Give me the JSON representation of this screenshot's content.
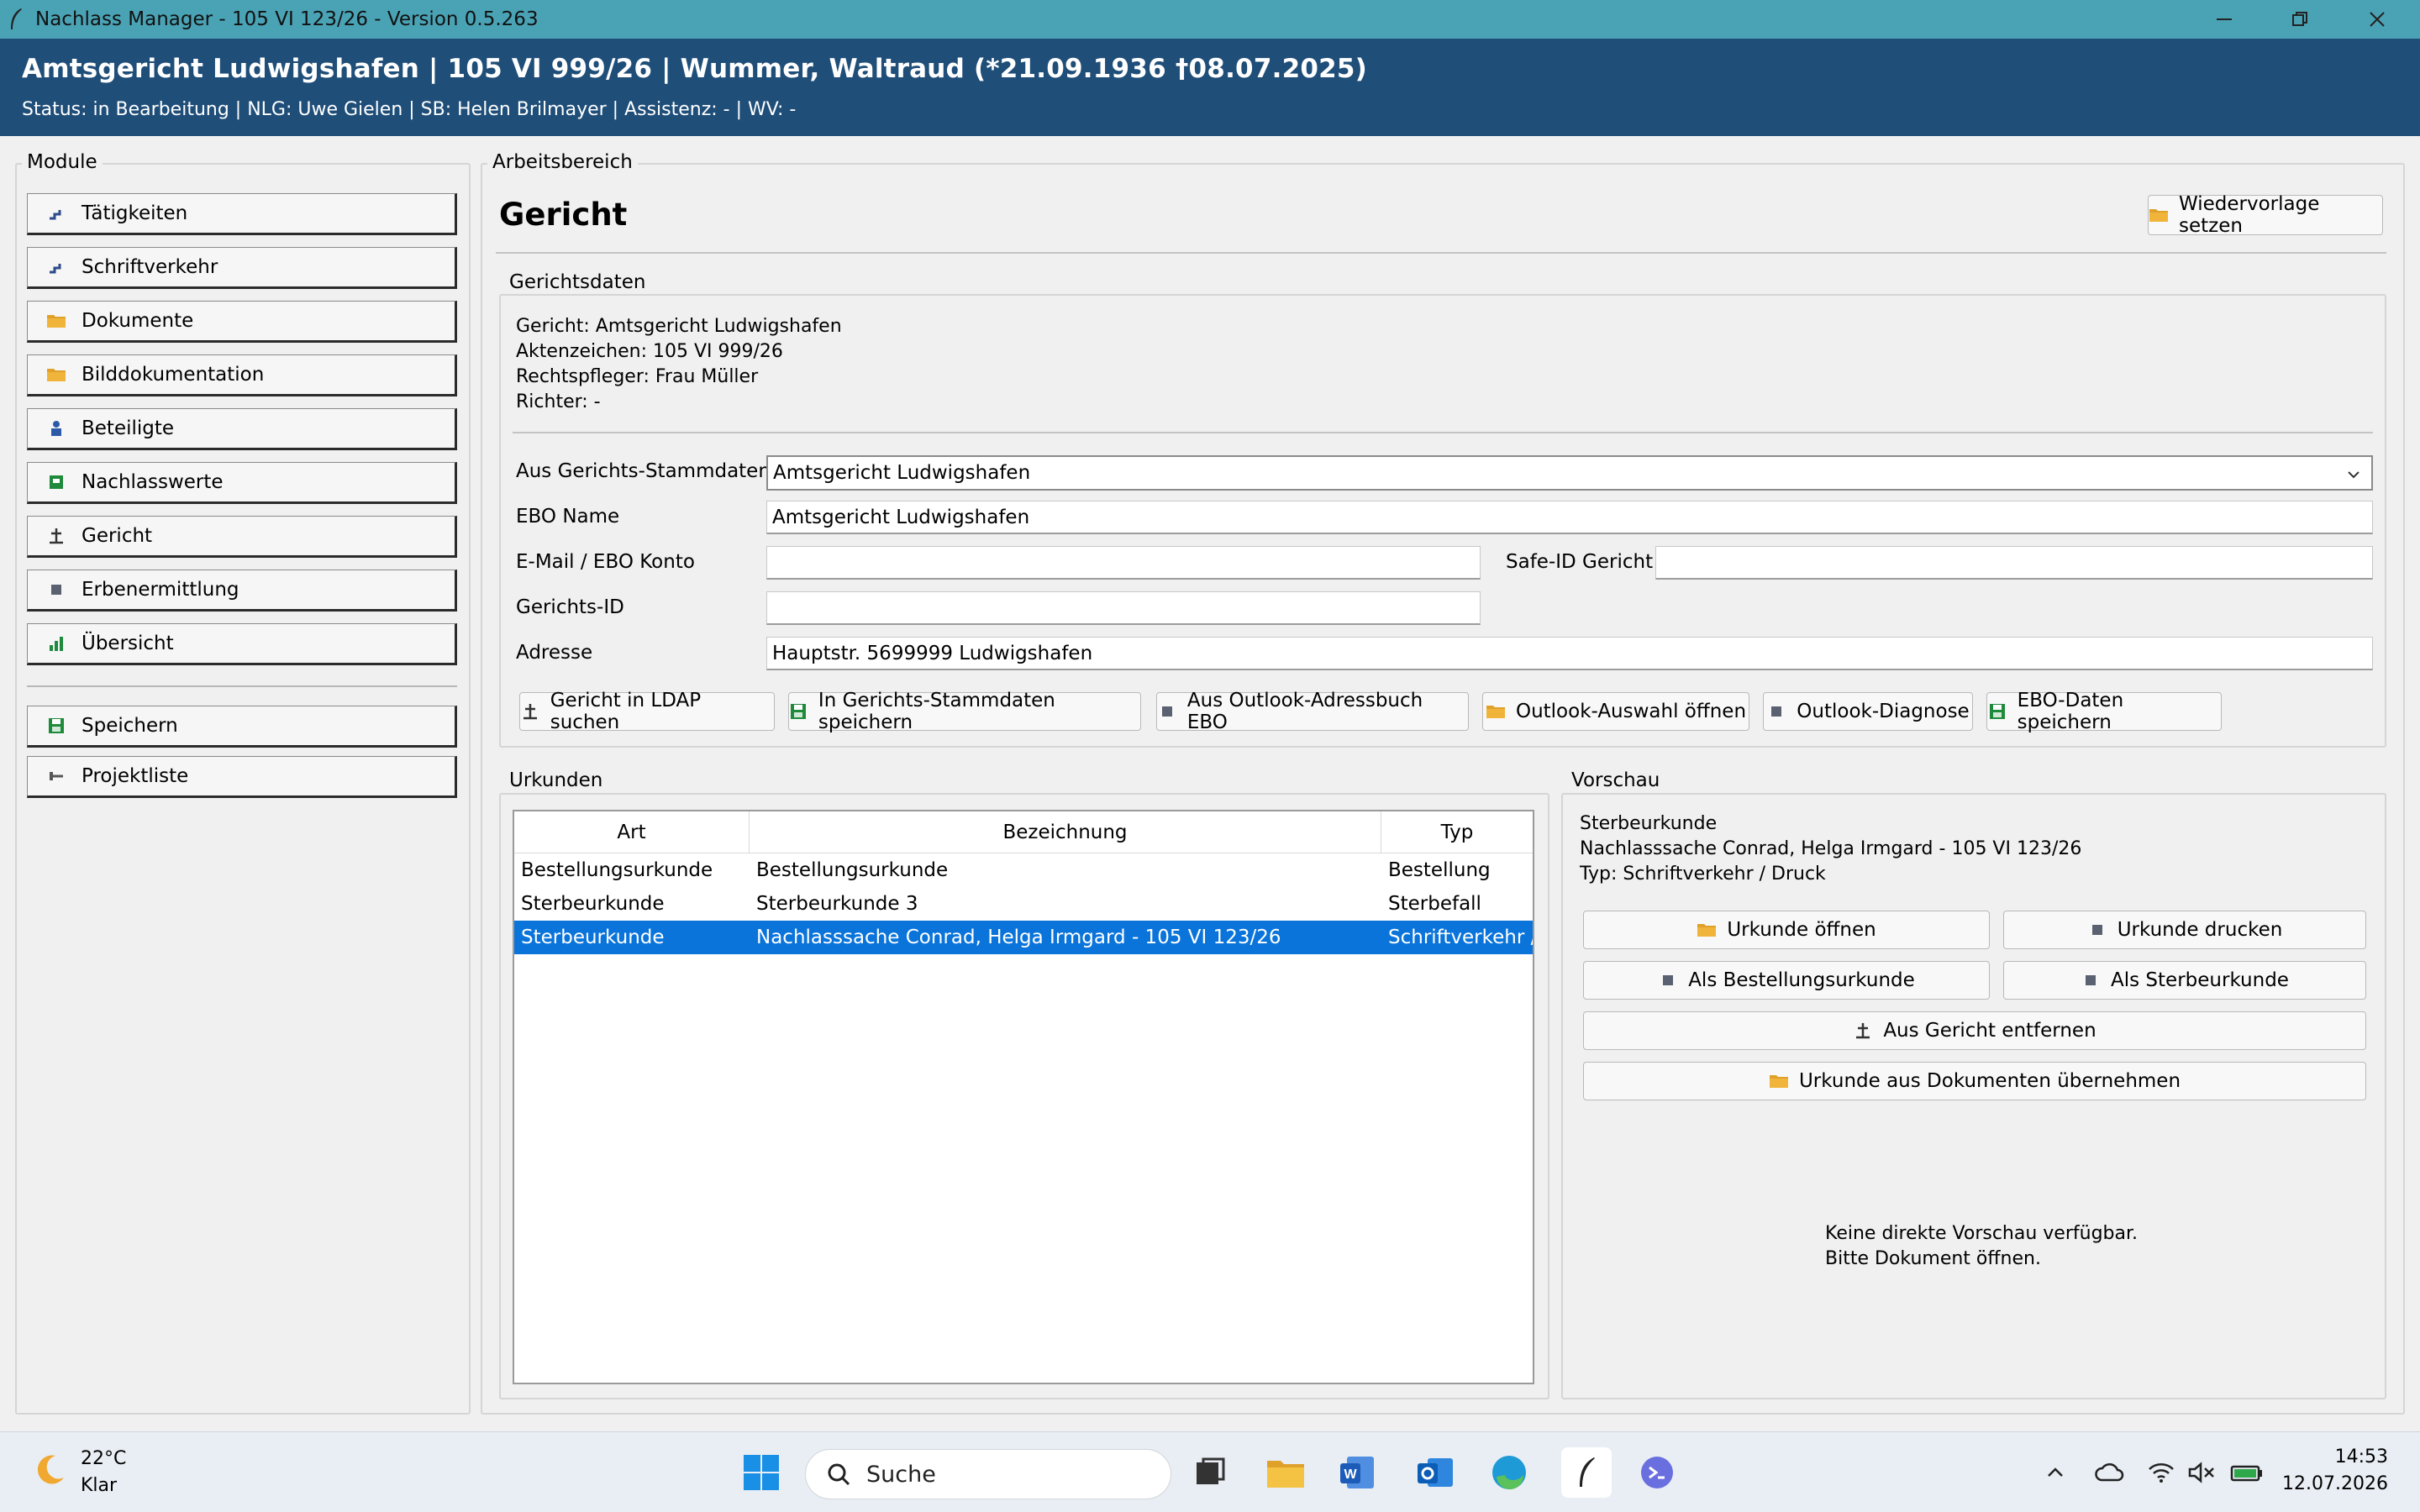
{
  "window": {
    "title": "Nachlass Manager - 105 VI 123/26 - Version 0.5.263"
  },
  "header": {
    "case": "Amtsgericht Ludwigshafen | 105 VI 999/26 | Wummer, Waltraud (*21.09.1936 †08.07.2025)",
    "status": "Status: in Bearbeitung | NLG: Uwe Gielen | SB: Helen Brilmayer | Assistenz: - | WV: -"
  },
  "modules": {
    "label": "Module",
    "items": [
      {
        "label": "Tätigkeiten",
        "icon": "stairs-icon"
      },
      {
        "label": "Schriftverkehr",
        "icon": "stairs-icon"
      },
      {
        "label": "Dokumente",
        "icon": "folder-icon"
      },
      {
        "label": "Bilddokumentation",
        "icon": "folder-icon"
      },
      {
        "label": "Beteiligte",
        "icon": "people-icon"
      },
      {
        "label": "Nachlasswerte",
        "icon": "square-green-icon"
      },
      {
        "label": "Gericht",
        "icon": "court-icon"
      },
      {
        "label": "Erbenermittlung",
        "icon": "square-icon"
      },
      {
        "label": "Übersicht",
        "icon": "bar-chart-icon"
      }
    ],
    "save": "Speichern",
    "projects": "Projektliste"
  },
  "workspace": {
    "label": "Arbeitsbereich",
    "title": "Gericht",
    "resubmit": "Wiedervorlage setzen"
  },
  "court_data": {
    "label": "Gerichtsdaten",
    "lines": [
      "Gericht: Amtsgericht Ludwigshafen",
      "Aktenzeichen: 105 VI 999/26",
      "Rechtspfleger: Frau Müller",
      "Richter: -"
    ],
    "master_label": "Aus Gerichts-Stammdaten",
    "master_value": "Amtsgericht Ludwigshafen",
    "ebo_name_label": "EBO Name",
    "ebo_name_value": "Amtsgericht Ludwigshafen",
    "email_label": "E-Mail / EBO Konto",
    "email_value": "",
    "safe_id_label": "Safe-ID Gericht",
    "safe_id_value": "",
    "court_id_label": "Gerichts-ID",
    "court_id_value": "",
    "address_label": "Adresse",
    "address_value": "Hauptstr. 5699999 Ludwigshafen",
    "buttons": {
      "ldap": "Gericht in LDAP suchen",
      "save_master": "In Gerichts-Stammdaten speichern",
      "outlook_book": "Aus Outlook-Adressbuch EBO",
      "outlook_select": "Outlook-Auswahl öffnen",
      "outlook_diag": "Outlook-Diagnose",
      "save_ebo": "EBO-Daten speichern"
    }
  },
  "documents": {
    "label": "Urkunden",
    "columns": [
      "Art",
      "Bezeichnung",
      "Typ"
    ],
    "rows": [
      {
        "art": "Bestellungsurkunde",
        "bezeichnung": "Bestellungsurkunde",
        "typ": "Bestellung"
      },
      {
        "art": "Sterbeurkunde",
        "bezeichnung": "Sterbeurkunde 3",
        "typ": "Sterbefall"
      },
      {
        "art": "Sterbeurkunde",
        "bezeichnung": "Nachlasssache Conrad, Helga Irmgard - 105 VI 123/26",
        "typ": "Schriftverkehr /"
      }
    ]
  },
  "preview": {
    "label": "Vorschau",
    "lines": [
      "Sterbeurkunde",
      "Nachlasssache Conrad, Helga Irmgard - 105 VI 123/26",
      "Typ: Schriftverkehr / Druck"
    ],
    "buttons": {
      "open": "Urkunde öffnen",
      "print": "Urkunde drucken",
      "as_order": "Als Bestellungsurkunde",
      "as_death": "Als Sterbeurkunde",
      "remove": "Aus Gericht entfernen",
      "take_over": "Urkunde aus Dokumenten übernehmen"
    },
    "no_preview_1": "Keine direkte Vorschau verfügbar.",
    "no_preview_2": "Bitte Dokument öffnen."
  },
  "taskbar": {
    "temperature": "22°C",
    "weather": "Klar",
    "search": "Suche",
    "time": "14:53",
    "date": "12.07.2026"
  },
  "colors": {
    "header": "#1f4e79",
    "titlebar": "#4aa3b5",
    "selection": "#0a74da",
    "folder": "#e0a12b",
    "save_green": "#1f8a3c"
  }
}
